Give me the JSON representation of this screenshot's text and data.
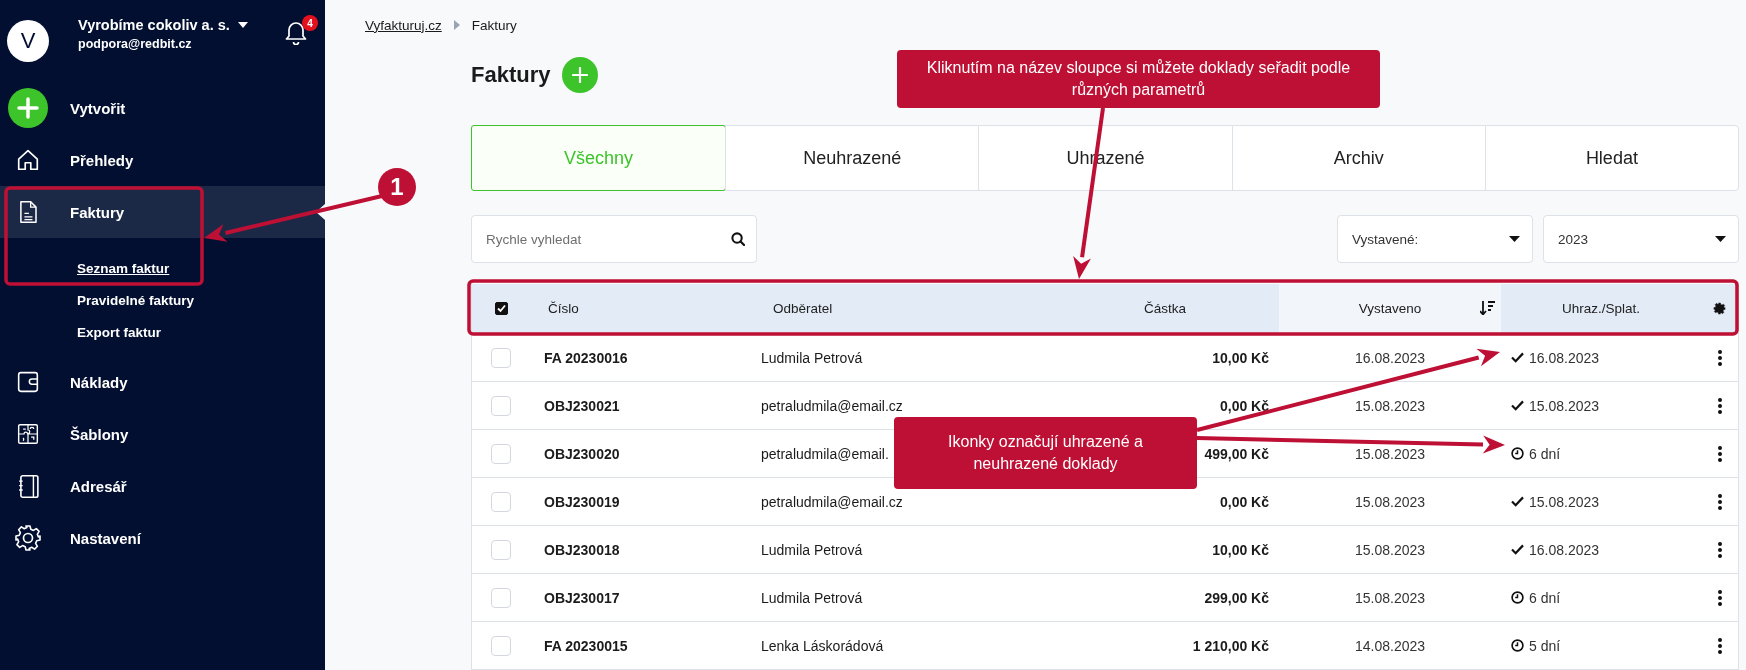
{
  "sidebar": {
    "account": {
      "avatar": "V",
      "company": "Vyrobíme cokoliv a. s.",
      "email": "podpora@redbit.cz"
    },
    "notifications": {
      "count": "4"
    },
    "items": [
      {
        "label": "Vytvořit",
        "kind": "create",
        "selected": false
      },
      {
        "label": "Přehledy",
        "kind": "home",
        "selected": false
      },
      {
        "label": "Faktury",
        "kind": "invoice",
        "selected": true,
        "children": [
          {
            "label": "Seznam faktur",
            "selected": true
          },
          {
            "label": "Pravidelné faktury",
            "selected": false
          },
          {
            "label": "Export faktur",
            "selected": false
          }
        ]
      },
      {
        "label": "Náklady",
        "kind": "wallet",
        "selected": false
      },
      {
        "label": "Šablony",
        "kind": "puzzle",
        "selected": false
      },
      {
        "label": "Adresář",
        "kind": "book",
        "selected": false
      },
      {
        "label": "Nastavení",
        "kind": "gear",
        "selected": false
      }
    ]
  },
  "breadcrumb": [
    "Vyfakturuj.cz",
    "Faktury"
  ],
  "page_title": "Faktury",
  "tabs": [
    {
      "label": "Všechny",
      "selected": true
    },
    {
      "label": "Neuhrazené",
      "selected": false
    },
    {
      "label": "Uhrazené",
      "selected": false
    },
    {
      "label": "Archiv",
      "selected": false
    },
    {
      "label": "Hledat",
      "selected": false
    }
  ],
  "search": {
    "placeholder": "Rychle vyhledat"
  },
  "filters": [
    {
      "value": "Vystavené:"
    },
    {
      "value": "2023"
    }
  ],
  "table": {
    "all_checked": true,
    "columns": [
      {
        "label": "Číslo",
        "sorted": false
      },
      {
        "label": "Odběratel",
        "sorted": false
      },
      {
        "label": "Částka",
        "sorted": false
      },
      {
        "label": "Vystaveno",
        "sorted": true
      },
      {
        "label": "Uhraz./Splat.",
        "sorted": false
      }
    ],
    "rows": [
      {
        "checked": false,
        "number": "FA 20230016",
        "customer": "Ludmila Petrová",
        "amount": "10,00 Kč",
        "issued": "16.08.2023",
        "kind": "paid",
        "payment": "16.08.2023"
      },
      {
        "checked": false,
        "number": "OBJ230021",
        "customer": "petraludmila@email.cz",
        "amount": "0,00 Kč",
        "issued": "15.08.2023",
        "kind": "paid",
        "payment": "15.08.2023"
      },
      {
        "checked": false,
        "number": "OBJ230020",
        "customer": "petraludmila@email.",
        "amount": "499,00 Kč",
        "issued": "15.08.2023",
        "kind": "due",
        "payment": "6 dní"
      },
      {
        "checked": false,
        "number": "OBJ230019",
        "customer": "petraludmila@email.cz",
        "amount": "0,00 Kč",
        "issued": "15.08.2023",
        "kind": "paid",
        "payment": "15.08.2023"
      },
      {
        "checked": false,
        "number": "OBJ230018",
        "customer": "Ludmila Petrová",
        "amount": "10,00 Kč",
        "issued": "15.08.2023",
        "kind": "paid",
        "payment": "16.08.2023"
      },
      {
        "checked": false,
        "number": "OBJ230017",
        "customer": "Ludmila Petrová",
        "amount": "299,00 Kč",
        "issued": "15.08.2023",
        "kind": "due",
        "payment": "6 dní"
      },
      {
        "checked": false,
        "number": "FA 20230015",
        "customer": "Lenka Láskorádová",
        "amount": "1 210,00 Kč",
        "issued": "14.08.2023",
        "kind": "due",
        "payment": "5 dní"
      }
    ]
  },
  "annotations": [
    {
      "kind": "step",
      "label": "1"
    },
    {
      "kind": "callout",
      "text": "Kliknutím na název sloupce si můžete doklady seřadit podle různých parametrů"
    },
    {
      "kind": "callout",
      "text": "Ikonky označují uhrazené a neuhrazené doklady"
    }
  ]
}
